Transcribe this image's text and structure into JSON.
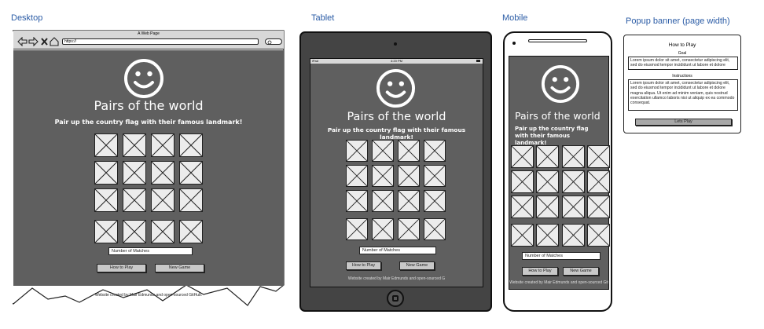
{
  "captions": {
    "desktop": "Desktop",
    "tablet": "Tablet",
    "mobile": "Mobile",
    "popup": "Popup banner (page width)"
  },
  "site": {
    "title": "Pairs of the world",
    "subtitle": "Pair up the country flag with their famous landmark!",
    "matches_placeholder": "Number of Matches",
    "how_to_play": "How to Play",
    "new_game": "New Game"
  },
  "desktop": {
    "window_title": "A Web Page",
    "url": "https://",
    "footer": "Website created by Mair Edmunds and open-sourced GitHub."
  },
  "tablet": {
    "status_left": "iPad",
    "status_time": "4:20 PM",
    "footer": "Website created by Mair Edmunds and open-sourced G"
  },
  "mobile": {
    "footer": "Website created by Mair Edmunds and open-sourced Git"
  },
  "popup": {
    "title": "How to Play",
    "section1": "Goal",
    "text1": "Lorem ipsum dolor sit amet, consectetur adipiscing elit, sed do eiusmod tempor incididunt ut labore et dolore",
    "section2": "Instructions",
    "text2": "Lorem ipsum dolor sit amet, consectetur adipiscing elit, sed do eiusmod tempor incididunt ut labore et dolore magna aliqua. Ut enim ad minim veniam, quis nostrud exercitation ullamco laboris nisi ut aliquip ex ea commodo consequat.",
    "button": "Lets Play"
  },
  "colors": {
    "screen": "#5f5f5f",
    "caption": "#2a5ba5",
    "tile": "#ececec",
    "button": "#c8c8c8",
    "device": "#444444"
  }
}
